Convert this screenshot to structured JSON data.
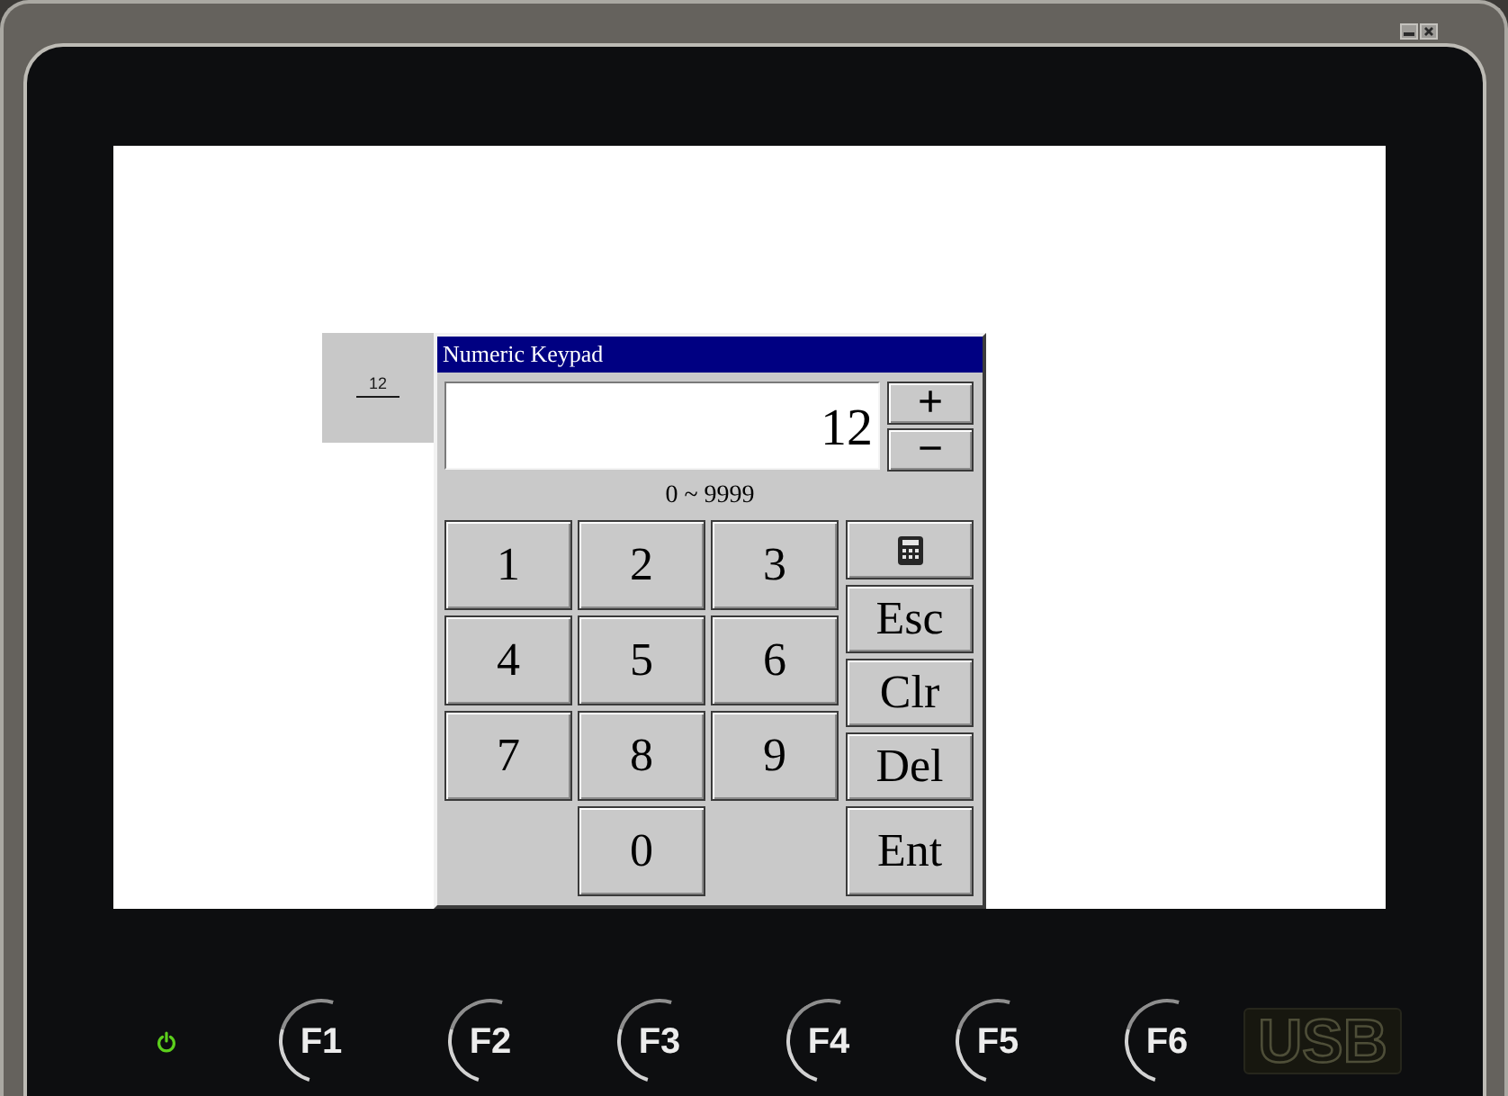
{
  "screen": {
    "numeric_input": {
      "value": "12"
    },
    "keypad": {
      "title": "Numeric Keypad",
      "display_value": "12",
      "step_buttons": [
        "+",
        "−"
      ],
      "range": "0 ~ 9999",
      "digit_rows": [
        [
          "1",
          "2",
          "3"
        ],
        [
          "4",
          "5",
          "6"
        ],
        [
          "7",
          "8",
          "9"
        ],
        [
          "0"
        ]
      ],
      "side_keys": [
        {
          "kind": "calculator"
        },
        {
          "kind": "text",
          "label": "Esc"
        },
        {
          "kind": "text",
          "label": "Clr"
        },
        {
          "kind": "text",
          "label": "Del"
        },
        {
          "kind": "text",
          "label": "Ent"
        }
      ]
    }
  },
  "bezel": {
    "power_led": {
      "on": true
    },
    "function_keys": [
      "F1",
      "F2",
      "F3",
      "F4",
      "F5",
      "F6"
    ],
    "usb_label": "USB"
  }
}
